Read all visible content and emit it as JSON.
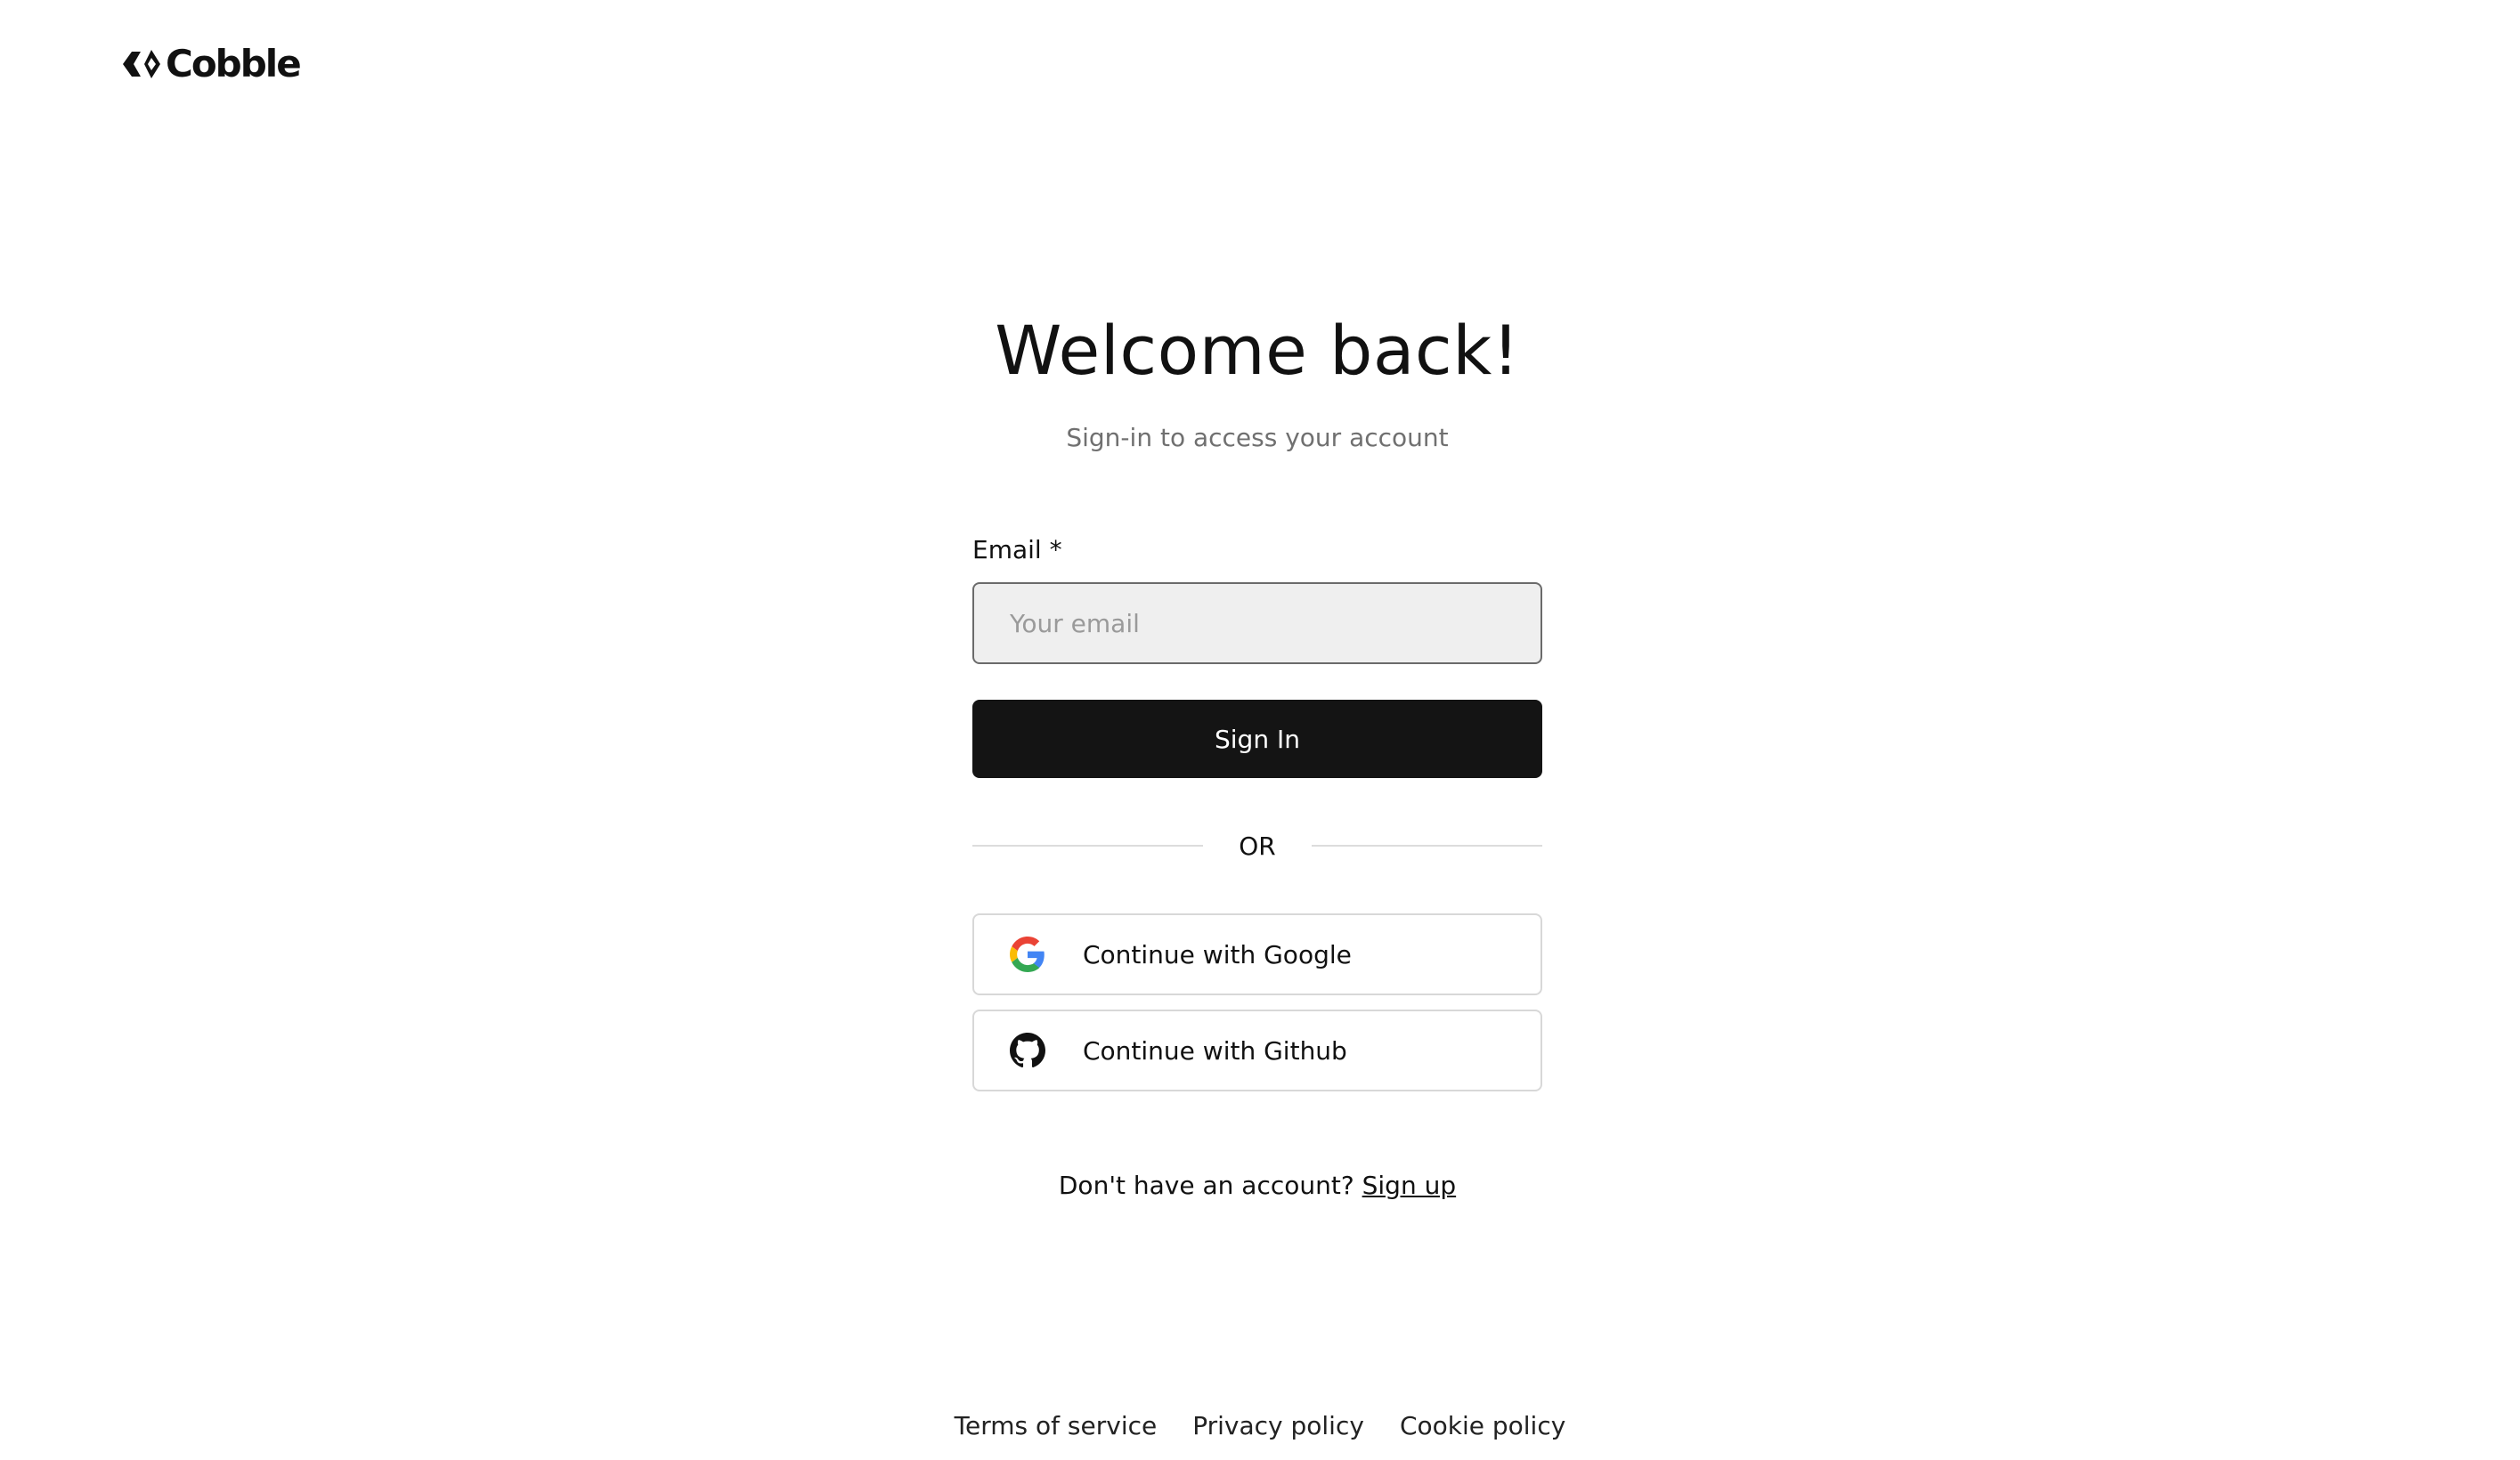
{
  "brand": {
    "name": "Cobble",
    "logo_icon": "cobble-logo-mark"
  },
  "header": {
    "title": "Welcome back!",
    "subtitle": "Sign-in to access your account"
  },
  "form": {
    "email_label": "Email *",
    "email_placeholder": "Your email",
    "email_value": "",
    "signin_label": "Sign In"
  },
  "divider": {
    "text": "OR"
  },
  "oauth": {
    "google": {
      "label": "Continue with Google",
      "icon": "google-icon"
    },
    "github": {
      "label": "Continue with Github",
      "icon": "github-icon"
    }
  },
  "signup": {
    "prompt": "Don't have an account?",
    "link_label": "Sign up"
  },
  "footer": {
    "links": [
      "Terms of service",
      "Privacy policy",
      "Cookie policy"
    ]
  },
  "colors": {
    "primary_button": "#141414",
    "input_background": "#efefef",
    "subtitle_text": "#707070"
  }
}
